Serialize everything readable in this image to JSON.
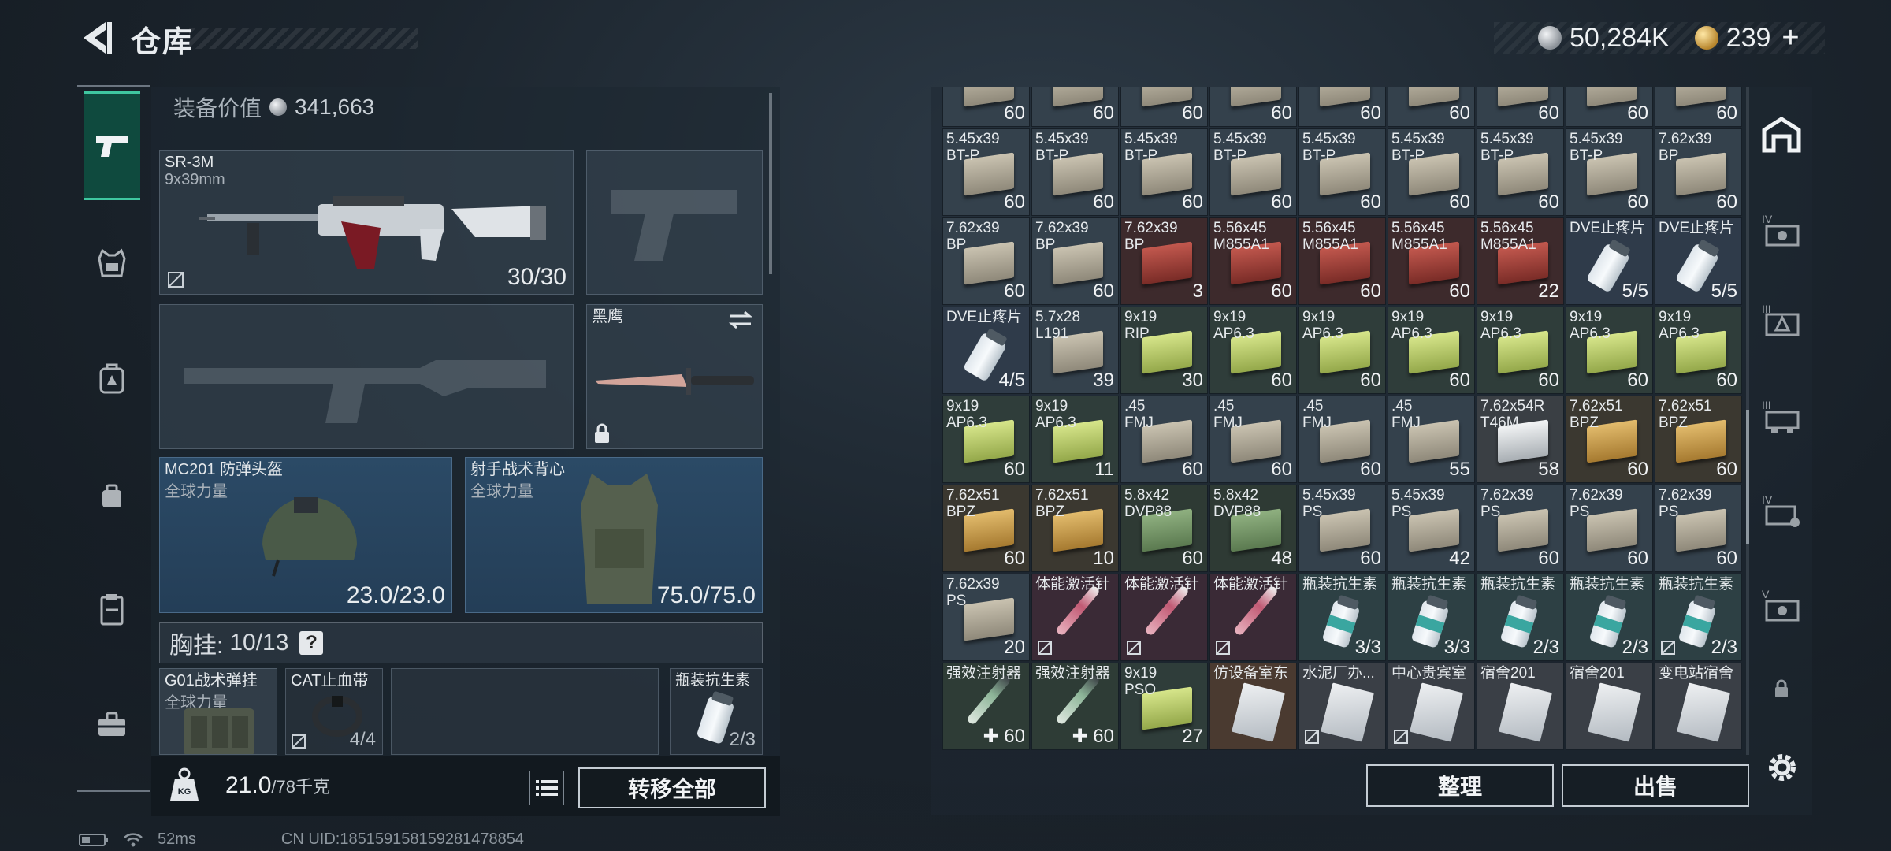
{
  "header": {
    "title": "仓库"
  },
  "currency": {
    "coins": "50,284K",
    "premium": "239",
    "plus": "+"
  },
  "equipment": {
    "value_label": "装备价值",
    "value": "341,663",
    "primary": {
      "name": "SR-3M",
      "caliber": "9x39mm",
      "ammo": "30/30"
    },
    "melee": {
      "name": "黑鹰"
    },
    "helmet": {
      "name": "MC201 防弹头盔",
      "brand": "全球力量",
      "durability": "23.0/23.0"
    },
    "vest": {
      "name": "射手战术背心",
      "brand": "全球力量",
      "durability": "75.0/75.0"
    },
    "chest_rig": {
      "label": "胸挂:",
      "capacity": "10/13",
      "help": "?"
    },
    "rig_items": [
      {
        "name": "G01战术弹挂",
        "sub": "全球力量",
        "count": ""
      },
      {
        "name": "CAT止血带",
        "sub": "",
        "count": "4/4"
      },
      {
        "name": "瓶装抗生素",
        "sub": "",
        "count": "2/3"
      }
    ],
    "weight": {
      "current": "21.0",
      "max": "/78千克"
    },
    "transfer_all": "转移全部"
  },
  "inventory": {
    "rows": [
      [
        {
          "n": "",
          "c": "60",
          "t": "ammo-sand"
        },
        {
          "n": "",
          "c": "60",
          "t": "ammo-sand"
        },
        {
          "n": "",
          "c": "60",
          "t": "ammo-sand"
        },
        {
          "n": "",
          "c": "60",
          "t": "ammo-sand"
        },
        {
          "n": "",
          "c": "60",
          "t": "ammo-sand"
        },
        {
          "n": "",
          "c": "60",
          "t": "ammo-sand"
        },
        {
          "n": "",
          "c": "60",
          "t": "ammo-sand"
        },
        {
          "n": "",
          "c": "60",
          "t": "ammo-sand"
        },
        {
          "n": "",
          "c": "60",
          "t": "ammo-sand"
        }
      ],
      [
        {
          "n": "5.45x39\nBT-P",
          "c": "60",
          "t": "ammo-sand"
        },
        {
          "n": "5.45x39\nBT-P",
          "c": "60",
          "t": "ammo-sand"
        },
        {
          "n": "5.45x39\nBT-P",
          "c": "60",
          "t": "ammo-sand"
        },
        {
          "n": "5.45x39\nBT-P",
          "c": "60",
          "t": "ammo-sand"
        },
        {
          "n": "5.45x39\nBT-P",
          "c": "60",
          "t": "ammo-sand"
        },
        {
          "n": "5.45x39\nBT-P",
          "c": "60",
          "t": "ammo-sand"
        },
        {
          "n": "5.45x39\nBT-P",
          "c": "60",
          "t": "ammo-sand"
        },
        {
          "n": "5.45x39\nBT-P",
          "c": "60",
          "t": "ammo-sand"
        },
        {
          "n": "7.62x39\nBP",
          "c": "60",
          "t": "ammo-sand"
        }
      ],
      [
        {
          "n": "7.62x39\nBP",
          "c": "60",
          "t": "ammo-sand"
        },
        {
          "n": "7.62x39\nBP",
          "c": "60",
          "t": "ammo-sand"
        },
        {
          "n": "7.62x39\nBP",
          "c": "3",
          "t": "ammo-red"
        },
        {
          "n": "5.56x45\nM855A1",
          "c": "60",
          "t": "ammo-red"
        },
        {
          "n": "5.56x45\nM855A1",
          "c": "60",
          "t": "ammo-red"
        },
        {
          "n": "5.56x45\nM855A1",
          "c": "60",
          "t": "ammo-red"
        },
        {
          "n": "5.56x45\nM855A1",
          "c": "22",
          "t": "ammo-red"
        },
        {
          "n": "DVE止疼片",
          "c": "5/5",
          "t": "pill"
        },
        {
          "n": "DVE止疼片",
          "c": "5/5",
          "t": "pill"
        }
      ],
      [
        {
          "n": "DVE止疼片",
          "c": "4/5",
          "t": "pill"
        },
        {
          "n": "5.7x28\nL191",
          "c": "39",
          "t": "ammo-sand"
        },
        {
          "n": "9x19\nRIP",
          "c": "30",
          "t": "ammo-lime"
        },
        {
          "n": "9x19\nAP6.3",
          "c": "60",
          "t": "ammo-lime"
        },
        {
          "n": "9x19\nAP6.3",
          "c": "60",
          "t": "ammo-lime"
        },
        {
          "n": "9x19\nAP6.3",
          "c": "60",
          "t": "ammo-lime"
        },
        {
          "n": "9x19\nAP6.3",
          "c": "60",
          "t": "ammo-lime"
        },
        {
          "n": "9x19\nAP6.3",
          "c": "60",
          "t": "ammo-lime"
        },
        {
          "n": "9x19\nAP6.3",
          "c": "60",
          "t": "ammo-lime"
        }
      ],
      [
        {
          "n": "9x19\nAP6.3",
          "c": "60",
          "t": "ammo-lime"
        },
        {
          "n": "9x19\nAP6.3",
          "c": "11",
          "t": "ammo-lime"
        },
        {
          "n": ".45\nFMJ",
          "c": "60",
          "t": "ammo-sand"
        },
        {
          "n": ".45\nFMJ",
          "c": "60",
          "t": "ammo-sand"
        },
        {
          "n": ".45\nFMJ",
          "c": "60",
          "t": "ammo-sand"
        },
        {
          "n": ".45\nFMJ",
          "c": "55",
          "t": "ammo-sand"
        },
        {
          "n": "7.62x54R\nT46M",
          "c": "58",
          "t": "ammo-white"
        },
        {
          "n": "7.62x51\nBPZ",
          "c": "60",
          "t": "ammo-gold"
        },
        {
          "n": "7.62x51\nBPZ",
          "c": "60",
          "t": "ammo-gold"
        }
      ],
      [
        {
          "n": "7.62x51\nBPZ",
          "c": "60",
          "t": "ammo-gold"
        },
        {
          "n": "7.62x51\nBPZ",
          "c": "10",
          "t": "ammo-gold"
        },
        {
          "n": "5.8x42\nDVP88",
          "c": "60",
          "t": "ammo-green"
        },
        {
          "n": "5.8x42\nDVP88",
          "c": "48",
          "t": "ammo-green"
        },
        {
          "n": "5.45x39\nPS",
          "c": "60",
          "t": "ammo-sand"
        },
        {
          "n": "5.45x39\nPS",
          "c": "42",
          "t": "ammo-sand"
        },
        {
          "n": "7.62x39\nPS",
          "c": "60",
          "t": "ammo-sand"
        },
        {
          "n": "7.62x39\nPS",
          "c": "60",
          "t": "ammo-sand"
        },
        {
          "n": "7.62x39\nPS",
          "c": "60",
          "t": "ammo-sand"
        }
      ],
      [
        {
          "n": "7.62x39\nPS",
          "c": "20",
          "t": "ammo-sand"
        },
        {
          "n": "体能激活针",
          "c": "",
          "t": "syringe-red",
          "lock": true
        },
        {
          "n": "体能激活针",
          "c": "",
          "t": "syringe-red",
          "lock": true
        },
        {
          "n": "体能激活针",
          "c": "",
          "t": "syringe-red",
          "lock": true
        },
        {
          "n": "瓶装抗生素",
          "c": "3/3",
          "t": "vial"
        },
        {
          "n": "瓶装抗生素",
          "c": "3/3",
          "t": "vial"
        },
        {
          "n": "瓶装抗生素",
          "c": "2/3",
          "t": "vial"
        },
        {
          "n": "瓶装抗生素",
          "c": "2/3",
          "t": "vial"
        },
        {
          "n": "瓶装抗生素",
          "c": "2/3",
          "t": "vial",
          "lock": true
        }
      ],
      [
        {
          "n": "强效注射器",
          "c": "✚ 60",
          "t": "syringe-green"
        },
        {
          "n": "强效注射器",
          "c": "✚ 60",
          "t": "syringe-green"
        },
        {
          "n": "9x19\nPSO",
          "c": "27",
          "t": "ammo-lime"
        },
        {
          "n": "仿设备室东",
          "c": "",
          "t": "key-card"
        },
        {
          "n": "水泥厂办...",
          "c": "",
          "t": "key-card",
          "lock": true
        },
        {
          "n": "中心贵宾室",
          "c": "",
          "t": "key-card",
          "lock": true
        },
        {
          "n": "宿舍201",
          "c": "",
          "t": "key-card"
        },
        {
          "n": "宿舍201",
          "c": "",
          "t": "key-card"
        },
        {
          "n": "变电站宿舍",
          "c": "",
          "t": "key-card"
        }
      ]
    ],
    "sort": "整理",
    "sell": "出售"
  },
  "status": {
    "ping": "52ms",
    "uid": "CN UID:1851591581592814788​54"
  }
}
